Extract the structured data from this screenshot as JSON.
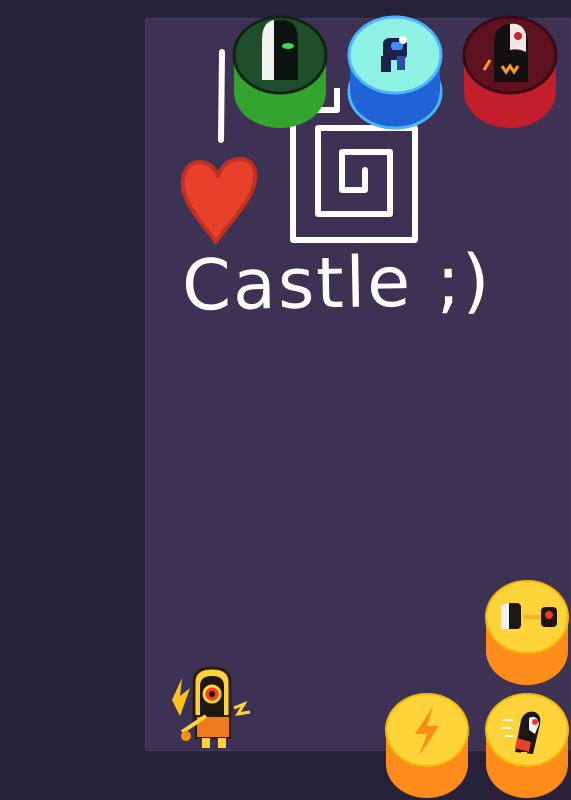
{
  "board": {
    "caption": "Castle ;)"
  },
  "colors": {
    "background": "#27223a",
    "board": "#3d3254",
    "green_token": "#3fbf3a",
    "blue_token": "#1f63d6",
    "red_token": "#c21e2c",
    "yellow_button": "#ffd43b",
    "orange_button": "#ff8c1a",
    "heart": "#e8402a"
  },
  "tokens": [
    {
      "id": "green",
      "icon": "ghost-character-icon"
    },
    {
      "id": "cyan-blue",
      "icon": "creature-character-icon"
    },
    {
      "id": "red",
      "icon": "demon-character-icon"
    }
  ],
  "controls": [
    {
      "id": "ability",
      "icon": "eye-laser-icon"
    },
    {
      "id": "power",
      "icon": "lightning-bolt-icon"
    },
    {
      "id": "dash",
      "icon": "dashing-character-icon"
    }
  ]
}
